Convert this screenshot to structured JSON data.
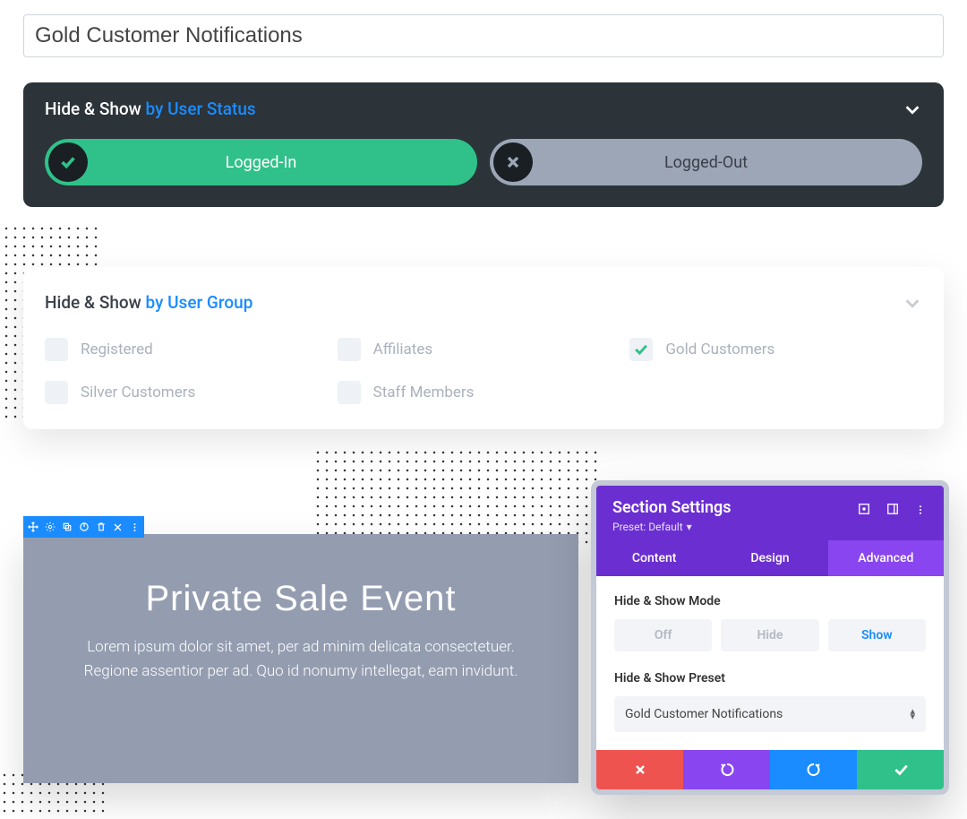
{
  "title_input": "Gold Customer Notifications",
  "status_panel": {
    "title_prefix": "Hide & Show ",
    "title_accent": "by User Status",
    "pills": {
      "logged_in": "Logged-In",
      "logged_out": "Logged-Out"
    }
  },
  "group_panel": {
    "title_prefix": "Hide & Show ",
    "title_accent": "by User Group",
    "items": [
      {
        "label": "Registered",
        "checked": false
      },
      {
        "label": "Affiliates",
        "checked": false
      },
      {
        "label": "Gold Customers",
        "checked": true
      },
      {
        "label": "Silver Customers",
        "checked": false
      },
      {
        "label": "Staff Members",
        "checked": false
      }
    ]
  },
  "hero": {
    "heading": "Private Sale Event",
    "body": "Lorem ipsum dolor sit amet, per ad minim delicata consectetuer. Regione assentior per ad. Quo id nonumy intellegat, eam invidunt."
  },
  "modal": {
    "title": "Section Settings",
    "preset_label": "Preset: Default",
    "tabs": {
      "content": "Content",
      "design": "Design",
      "advanced": "Advanced"
    },
    "mode": {
      "label": "Hide & Show Mode",
      "off": "Off",
      "hide": "Hide",
      "show": "Show"
    },
    "preset_field": {
      "label": "Hide & Show Preset",
      "value": "Gold Customer Notifications"
    }
  }
}
